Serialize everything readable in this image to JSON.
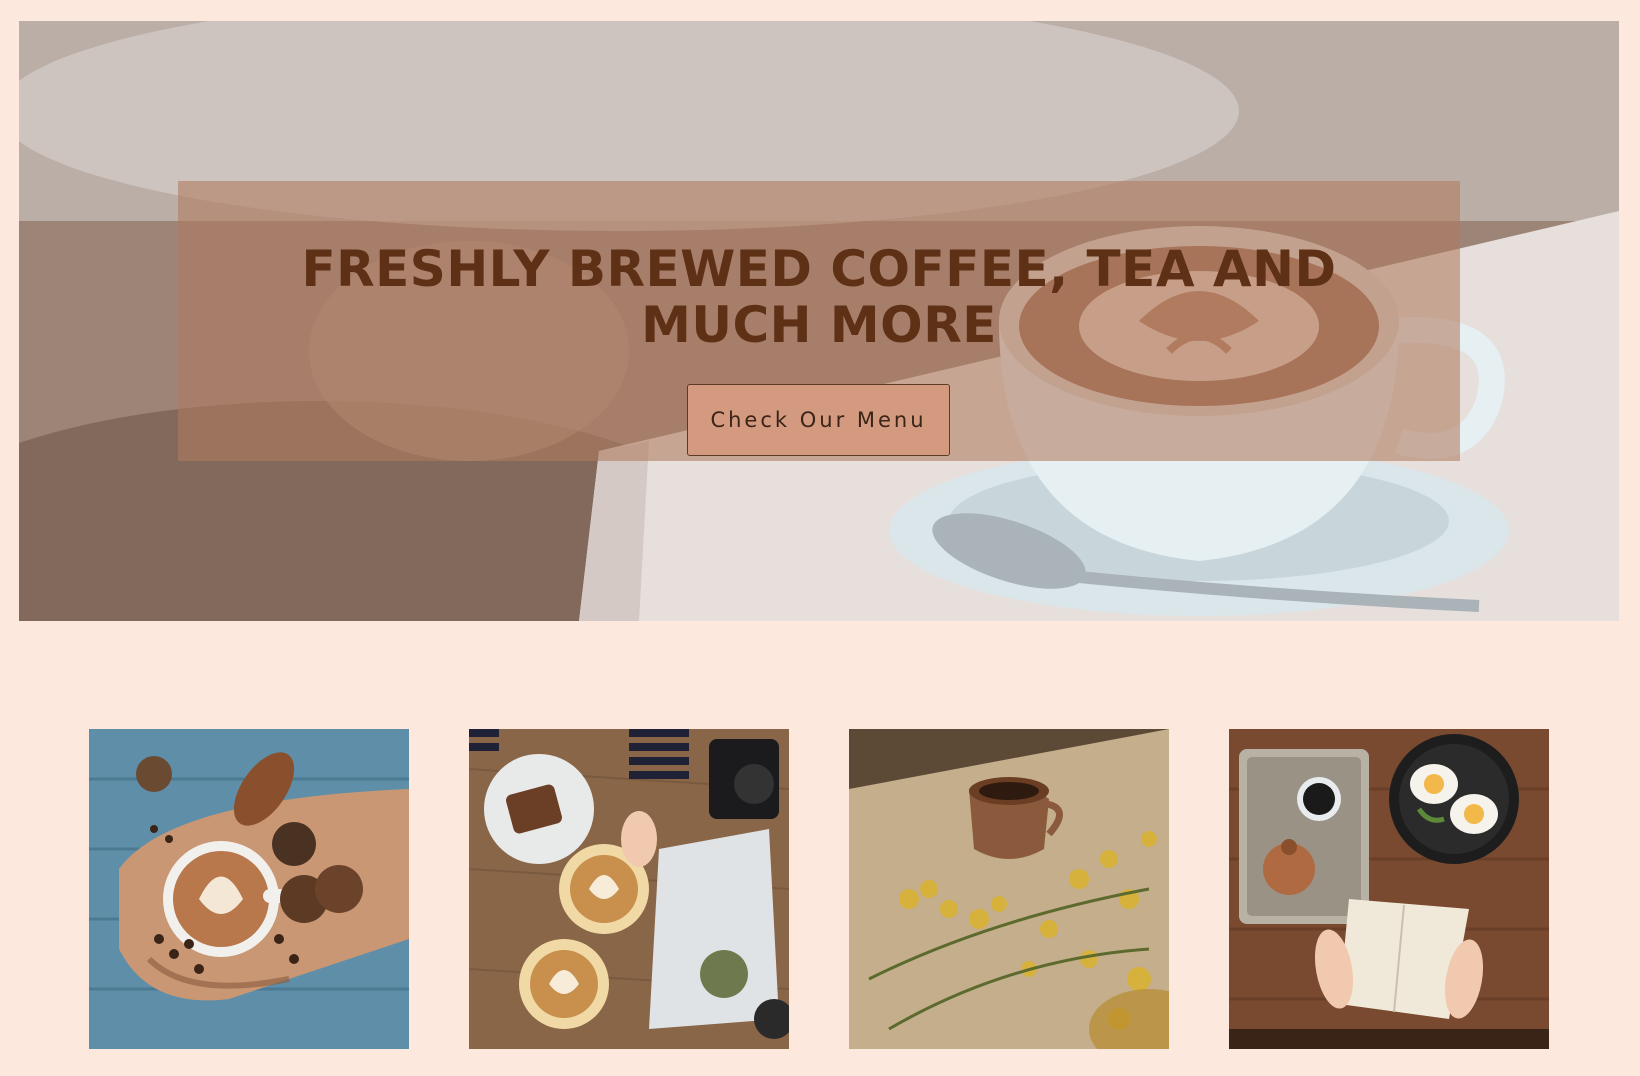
{
  "hero": {
    "title": "FRESHLY BREWED COFFEE, TEA AND MUCH MORE",
    "button_label": "Check Our Menu"
  },
  "gallery": {
    "photos": [
      {
        "subject": "latte with cookies on wooden board"
      },
      {
        "subject": "two lattes, cake and camera on table"
      },
      {
        "subject": "coffee cup among yellow flowers"
      },
      {
        "subject": "tray with teapot, eggs and open book"
      }
    ]
  },
  "colors": {
    "page_background": "#fde8de",
    "overlay": "#b07a5e",
    "title_text": "#5e3116",
    "button_background": "#d49a80"
  }
}
